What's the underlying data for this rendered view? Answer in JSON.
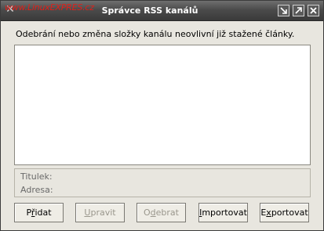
{
  "watermark": "www.LinuxEXPRES.cz",
  "window": {
    "title": "Správce RSS kanálů",
    "controls": [
      "minimize",
      "maximize",
      "close"
    ]
  },
  "message": "Odebrání nebo změna složky kanálu neovlivní již stažené články.",
  "details": {
    "title_label": "Titulek:",
    "address_label": "Adresa:"
  },
  "buttons": {
    "add": {
      "pre": "P",
      "ul": "ř",
      "post": "idat"
    },
    "edit": {
      "pre": "",
      "ul": "U",
      "post": "pravit"
    },
    "remove": {
      "pre": "O",
      "ul": "d",
      "post": "ebrat"
    },
    "import": {
      "pre": "",
      "ul": "I",
      "post": "mportovat"
    },
    "export": {
      "pre": "E",
      "ul": "x",
      "post": "portovat"
    }
  }
}
